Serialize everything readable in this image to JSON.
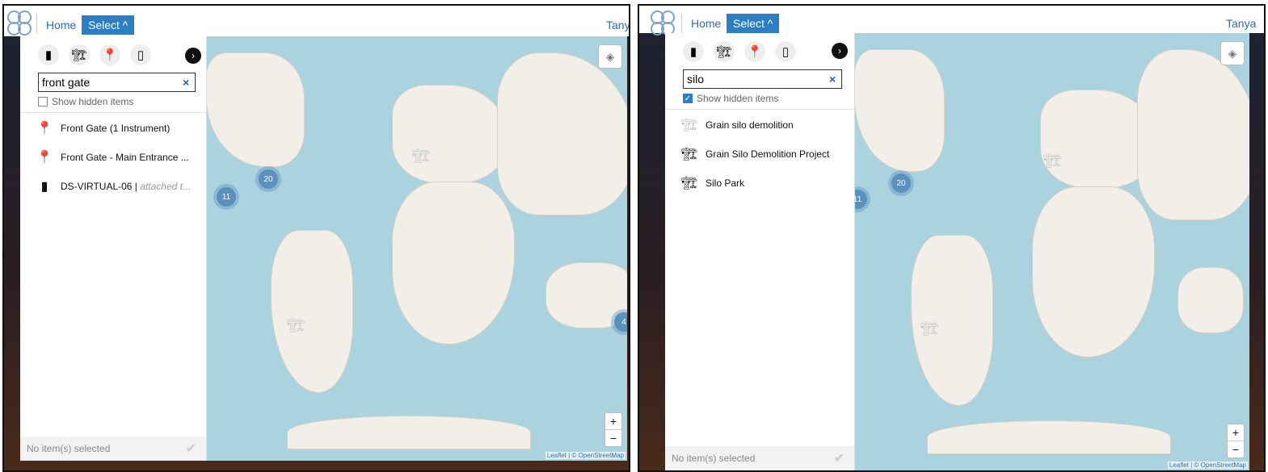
{
  "left": {
    "nav": {
      "home": "Home",
      "select": "Select ^"
    },
    "user": "Tanya",
    "search": {
      "value": "front gate"
    },
    "show_hidden": {
      "label": "Show hidden items",
      "checked": false
    },
    "results": [
      {
        "icon": "location-pin-icon",
        "label": "Front Gate (1 Instrument)",
        "suffix": ""
      },
      {
        "icon": "location-pin-icon",
        "label": "Front Gate - Main Entrance ...",
        "suffix": ""
      },
      {
        "icon": "instrument-icon",
        "label": "DS-VIRTUAL-06 | ",
        "suffix": "attached t..."
      }
    ],
    "clusters": [
      "20",
      "11",
      "4"
    ],
    "footer": "No item(s) selected",
    "attribution": "Leaflet | © OpenStreetMap"
  },
  "right": {
    "nav": {
      "home": "Home",
      "select": "Select ^"
    },
    "user": "Tanya ˅",
    "search": {
      "value": "silo"
    },
    "show_hidden": {
      "label": "Show hidden items",
      "checked": true
    },
    "results": [
      {
        "icon": "crane-icon",
        "label": "Grain silo demolition"
      },
      {
        "icon": "crane-icon",
        "label": "Grain Silo Demolition Project"
      },
      {
        "icon": "crane-icon",
        "label": "Silo Park"
      }
    ],
    "clusters": [
      "20",
      "11"
    ],
    "footer": "No item(s) selected",
    "attribution": "Leaflet | © OpenStreetMap"
  },
  "icons": {
    "filters": [
      "building-icon",
      "crane-icon",
      "location-pin-icon",
      "instrument-icon"
    ]
  },
  "zoom": {
    "in": "+",
    "out": "−"
  }
}
